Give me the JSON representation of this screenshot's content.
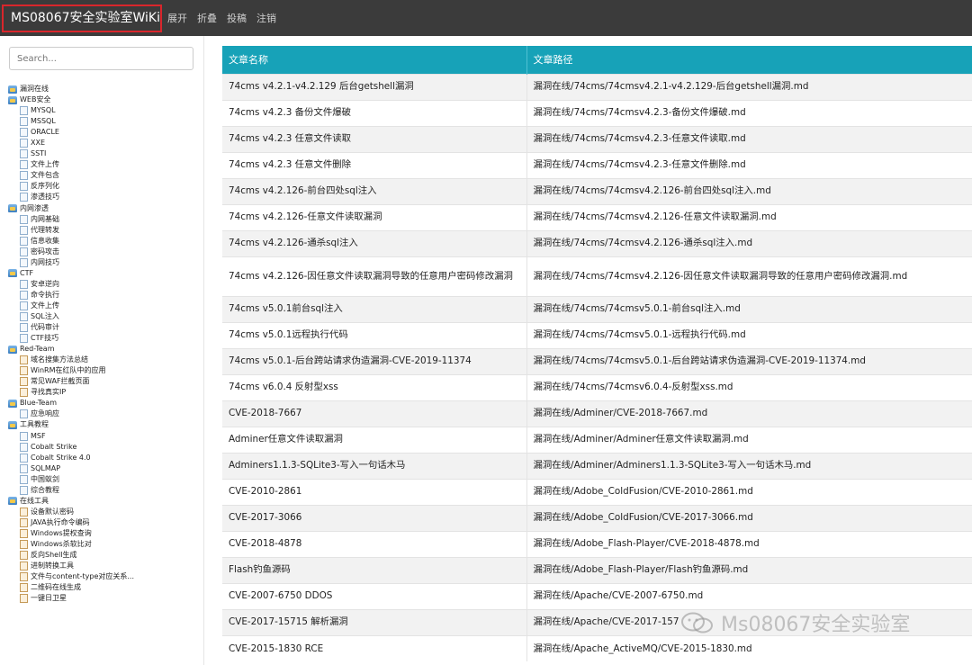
{
  "navbar": {
    "brand": "MS08067安全实验室WiKi",
    "links": [
      "展开",
      "折叠",
      "投稿",
      "注销"
    ]
  },
  "sidebar": {
    "search_placeholder": "Search...",
    "tree": [
      {
        "label": "漏洞在线",
        "level": 0,
        "icon": "folder-icon"
      },
      {
        "label": "WEB安全",
        "level": 0,
        "icon": "folder-icon"
      },
      {
        "label": "MYSQL",
        "level": 1,
        "icon": "document-icon"
      },
      {
        "label": "MSSQL",
        "level": 1,
        "icon": "document-icon"
      },
      {
        "label": "ORACLE",
        "level": 1,
        "icon": "document-icon"
      },
      {
        "label": "XXE",
        "level": 1,
        "icon": "document-icon"
      },
      {
        "label": "SSTI",
        "level": 1,
        "icon": "document-icon"
      },
      {
        "label": "文件上传",
        "level": 1,
        "icon": "document-icon"
      },
      {
        "label": "文件包含",
        "level": 1,
        "icon": "document-icon"
      },
      {
        "label": "反序列化",
        "level": 1,
        "icon": "document-icon"
      },
      {
        "label": "渗透技巧",
        "level": 1,
        "icon": "document-icon"
      },
      {
        "label": "内网渗透",
        "level": 0,
        "icon": "folder-icon"
      },
      {
        "label": "内网基础",
        "level": 1,
        "icon": "document-icon"
      },
      {
        "label": "代理转发",
        "level": 1,
        "icon": "document-icon"
      },
      {
        "label": "信息收集",
        "level": 1,
        "icon": "document-icon"
      },
      {
        "label": "密码攻击",
        "level": 1,
        "icon": "document-icon"
      },
      {
        "label": "内网技巧",
        "level": 1,
        "icon": "document-icon"
      },
      {
        "label": "CTF",
        "level": 0,
        "icon": "folder-icon"
      },
      {
        "label": "安卓逆向",
        "level": 1,
        "icon": "document-icon"
      },
      {
        "label": "命令执行",
        "level": 1,
        "icon": "document-icon"
      },
      {
        "label": "文件上传",
        "level": 1,
        "icon": "document-icon"
      },
      {
        "label": "SQL注入",
        "level": 1,
        "icon": "document-icon"
      },
      {
        "label": "代码审计",
        "level": 1,
        "icon": "document-icon"
      },
      {
        "label": "CTF技巧",
        "level": 1,
        "icon": "document-icon"
      },
      {
        "label": "Red-Team",
        "level": 0,
        "icon": "folder-icon"
      },
      {
        "label": "域名搜集方法总结",
        "level": 1,
        "icon": "tool-icon"
      },
      {
        "label": "WinRM在红队中的应用",
        "level": 1,
        "icon": "tool-icon"
      },
      {
        "label": "常见WAF拦截页面",
        "level": 1,
        "icon": "tool-icon"
      },
      {
        "label": "寻找真实IP",
        "level": 1,
        "icon": "tool-icon"
      },
      {
        "label": "Blue-Team",
        "level": 0,
        "icon": "folder-icon"
      },
      {
        "label": "应急响应",
        "level": 1,
        "icon": "document-icon"
      },
      {
        "label": "工具教程",
        "level": 0,
        "icon": "folder-icon"
      },
      {
        "label": "MSF",
        "level": 1,
        "icon": "document-icon"
      },
      {
        "label": "Cobalt Strike",
        "level": 1,
        "icon": "document-icon"
      },
      {
        "label": "Cobalt Strike 4.0",
        "level": 1,
        "icon": "document-icon"
      },
      {
        "label": "SQLMAP",
        "level": 1,
        "icon": "document-icon"
      },
      {
        "label": "中国蚁剑",
        "level": 1,
        "icon": "document-icon"
      },
      {
        "label": "综合教程",
        "level": 1,
        "icon": "document-icon"
      },
      {
        "label": "在线工具",
        "level": 0,
        "icon": "folder-icon"
      },
      {
        "label": "设备默认密码",
        "level": 1,
        "icon": "tool-icon"
      },
      {
        "label": "JAVA执行命令编码",
        "level": 1,
        "icon": "tool-icon"
      },
      {
        "label": "Windows提权查询",
        "level": 1,
        "icon": "tool-icon"
      },
      {
        "label": "Windows杀软比对",
        "level": 1,
        "icon": "tool-icon"
      },
      {
        "label": "反向Shell生成",
        "level": 1,
        "icon": "tool-icon"
      },
      {
        "label": "进制转换工具",
        "level": 1,
        "icon": "tool-icon"
      },
      {
        "label": "文件与content-type对应关系...",
        "level": 1,
        "icon": "tool-icon"
      },
      {
        "label": "二维码在线生成",
        "level": 1,
        "icon": "tool-icon"
      },
      {
        "label": "一键日卫星",
        "level": 1,
        "icon": "tool-icon"
      }
    ]
  },
  "table": {
    "headers": [
      "文章名称",
      "文章路径"
    ],
    "rows": [
      {
        "name": "74cms v4.2.1-v4.2.129 后台getshell漏洞",
        "path": "漏洞在线/74cms/74cmsv4.2.1-v4.2.129-后台getshell漏洞.md"
      },
      {
        "name": "74cms v4.2.3 备份文件爆破",
        "path": "漏洞在线/74cms/74cmsv4.2.3-备份文件爆破.md"
      },
      {
        "name": "74cms v4.2.3 任意文件读取",
        "path": "漏洞在线/74cms/74cmsv4.2.3-任意文件读取.md"
      },
      {
        "name": "74cms v4.2.3 任意文件删除",
        "path": "漏洞在线/74cms/74cmsv4.2.3-任意文件删除.md"
      },
      {
        "name": "74cms v4.2.126-前台四处sql注入",
        "path": "漏洞在线/74cms/74cmsv4.2.126-前台四处sql注入.md"
      },
      {
        "name": "74cms v4.2.126-任意文件读取漏洞",
        "path": "漏洞在线/74cms/74cmsv4.2.126-任意文件读取漏洞.md"
      },
      {
        "name": "74cms v4.2.126-通杀sql注入",
        "path": "漏洞在线/74cms/74cmsv4.2.126-通杀sql注入.md"
      },
      {
        "name": "74cms v4.2.126-因任意文件读取漏洞导致的任意用户密码修改漏洞",
        "path": "漏洞在线/74cms/74cmsv4.2.126-因任意文件读取漏洞导致的任意用户密码修改漏洞.md"
      },
      {
        "name": "74cms v5.0.1前台sql注入",
        "path": "漏洞在线/74cms/74cmsv5.0.1-前台sql注入.md"
      },
      {
        "name": "74cms v5.0.1远程执行代码",
        "path": "漏洞在线/74cms/74cmsv5.0.1-远程执行代码.md"
      },
      {
        "name": "74cms v5.0.1-后台跨站请求伪造漏洞-CVE-2019-11374",
        "path": "漏洞在线/74cms/74cmsv5.0.1-后台跨站请求伪造漏洞-CVE-2019-11374.md"
      },
      {
        "name": "74cms v6.0.4 反射型xss",
        "path": "漏洞在线/74cms/74cmsv6.0.4-反射型xss.md"
      },
      {
        "name": "CVE-2018-7667",
        "path": "漏洞在线/Adminer/CVE-2018-7667.md"
      },
      {
        "name": "Adminer任意文件读取漏洞",
        "path": "漏洞在线/Adminer/Adminer任意文件读取漏洞.md"
      },
      {
        "name": "Adminers1.1.3-SQLite3-写入一句话木马",
        "path": "漏洞在线/Adminer/Adminers1.1.3-SQLite3-写入一句话木马.md"
      },
      {
        "name": "CVE-2010-2861",
        "path": "漏洞在线/Adobe_ColdFusion/CVE-2010-2861.md"
      },
      {
        "name": "CVE-2017-3066",
        "path": "漏洞在线/Adobe_ColdFusion/CVE-2017-3066.md"
      },
      {
        "name": "CVE-2018-4878",
        "path": "漏洞在线/Adobe_Flash-Player/CVE-2018-4878.md"
      },
      {
        "name": "Flash钓鱼源码",
        "path": "漏洞在线/Adobe_Flash-Player/Flash钓鱼源码.md"
      },
      {
        "name": "CVE-2007-6750 DDOS",
        "path": "漏洞在线/Apache/CVE-2007-6750.md"
      },
      {
        "name": "CVE-2017-15715 解析漏洞",
        "path": "漏洞在线/Apache/CVE-2017-157"
      },
      {
        "name": "CVE-2015-1830 RCE",
        "path": "漏洞在线/Apache_ActiveMQ/CVE-2015-1830.md"
      }
    ]
  },
  "watermark": {
    "text": "Ms08067安全实验室",
    "icon": "wechat-icon",
    "color": "#969696"
  },
  "colors": {
    "navbar_bg": "#3b3b3b",
    "brand_border": "#d9262c",
    "table_header_bg": "#17a2b8",
    "row_stripe": "#f2f2f2"
  }
}
